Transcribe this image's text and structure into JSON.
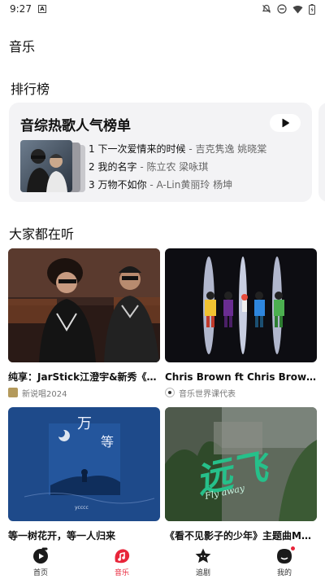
{
  "status_bar": {
    "time": "9:27",
    "notif_letter": "A"
  },
  "header": {
    "title": "音乐"
  },
  "ranking": {
    "section_title": "排行榜",
    "card": {
      "title": "音综热歌人气榜单",
      "songs": [
        {
          "rank": "1",
          "name": "下一次爱情来的时候",
          "artist": "- 吉克隽逸 姚晓棠"
        },
        {
          "rank": "2",
          "name": "我的名字",
          "artist": "- 陈立农 梁咏琪"
        },
        {
          "rank": "3",
          "name": "万物不如你",
          "artist": "- A-Lin黄丽玲 杨坤"
        }
      ]
    }
  },
  "listening": {
    "section_title": "大家都在听",
    "items": [
      {
        "title": "纯享：JarStick江澄宇&新秀《成…",
        "source": "新说唱2024"
      },
      {
        "title": "Chris Brown ft Chris Brown ft ク…",
        "source": "音乐世界课代表"
      },
      {
        "title": "等一树花开，等一人归来",
        "source": "",
        "cover_text_main": "万",
        "cover_text_sub": "等",
        "cover_caption": "ycccc"
      },
      {
        "title": "《看不见影子的少年》主题曲MV…",
        "source": "",
        "cover_text": "远飞",
        "cover_sub": "Fly away"
      }
    ]
  },
  "bottom_nav": {
    "items": [
      {
        "label": "首页",
        "icon": "home-disc-icon"
      },
      {
        "label": "音乐",
        "icon": "music-icon"
      },
      {
        "label": "追剧",
        "icon": "star-icon"
      },
      {
        "label": "我的",
        "icon": "profile-icon"
      }
    ],
    "active_index": 1
  },
  "colors": {
    "accent": "#e8253a",
    "card_bg": "#f3f3f5"
  }
}
